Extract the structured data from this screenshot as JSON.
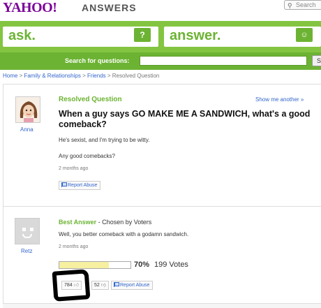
{
  "header": {
    "logo_text": "YAHOO!",
    "section": "ANSWERS",
    "top_search_placeholder": "Search"
  },
  "action_bar": {
    "ask_label": "ask.",
    "ask_icon": "?",
    "answer_label": "answer.",
    "answer_icon": "smiley-icon"
  },
  "search_bar": {
    "label": "Search for questions:",
    "input_value": "",
    "button_label": "Sear"
  },
  "breadcrumb": [
    "Home",
    "Family & Relationships",
    "Friends",
    "Resolved Question"
  ],
  "question": {
    "status": "Resolved Question",
    "show_another": "Show me another »",
    "asker": "Anna",
    "title": "When a guy says GO MAKE ME A SANDWICH, what's a good comeback?",
    "body_line1": "He's sexist, and I'm trying to be witty.",
    "body_line2": "Any good comebacks?",
    "time": "2 months ago",
    "report_label": "Report Abuse"
  },
  "best_answer": {
    "label": "Best Answer",
    "chosen_by": " - Chosen by Voters",
    "answerer": "Retz",
    "body": "Well, you better comeback with a godamn sandwich.",
    "time": "2 months ago",
    "vote_percent_text": "70%",
    "vote_fraction": 0.7,
    "votes_text": "199 Votes",
    "thumbs_up": "784",
    "thumbs_down": "52",
    "report_label": "Report Abuse"
  },
  "colors": {
    "yahoo_purple": "#7b0099",
    "green": "#83c541",
    "dark_green": "#6cb333",
    "link_blue": "#3366cc"
  }
}
